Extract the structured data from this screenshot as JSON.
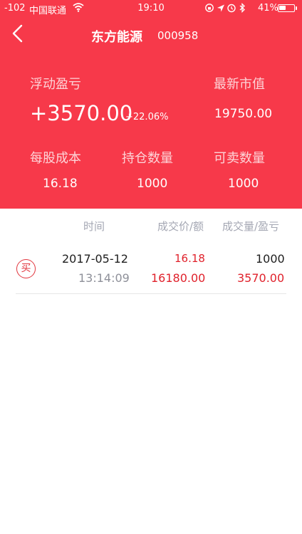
{
  "status_bar": {
    "signal": "-102",
    "carrier": "中国联通",
    "time": "19:10",
    "battery_percent": "41%"
  },
  "header": {
    "title": "东方能源",
    "code": "000958"
  },
  "stats": {
    "floating_pl_label": "浮动盈亏",
    "floating_pl_value": "+3570.00",
    "floating_pl_percent": "+22.06%",
    "market_value_label": "最新市值",
    "market_value": "19750.00",
    "cost_label": "每股成本",
    "cost_value": "16.18",
    "holding_label": "持仓数量",
    "holding_value": "1000",
    "sellable_label": "可卖数量",
    "sellable_value": "1000"
  },
  "table": {
    "col_time": "时间",
    "col_price": "成交价/额",
    "col_qty": "成交量/盈亏",
    "rows": [
      {
        "type": "买",
        "date": "2017-05-12",
        "time": "13:14:09",
        "price": "16.18",
        "amount": "16180.00",
        "qty": "1000",
        "pl": "3570.00"
      }
    ]
  },
  "colors": {
    "header_red": "#f7394a",
    "value_red": "#e0222c",
    "muted_gray": "#a4a7b3"
  }
}
